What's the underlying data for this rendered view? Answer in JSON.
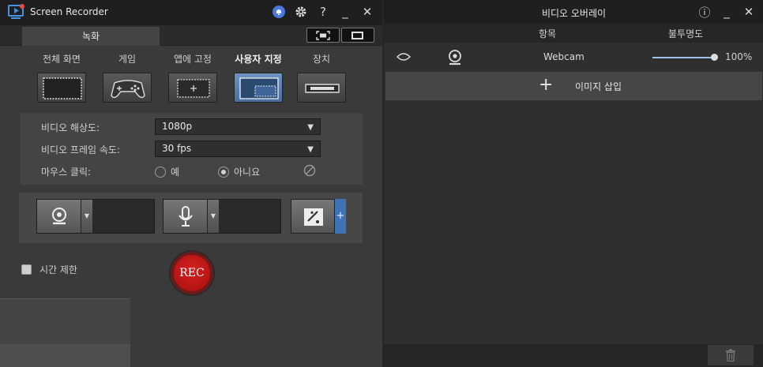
{
  "app": {
    "title": "Screen Recorder",
    "accent_color": "#4a78c0",
    "rec_color": "#c51616"
  },
  "titlebar": {
    "icons": [
      "notification-bell-icon",
      "gear-icon",
      "help-icon",
      "minimize-icon",
      "close-icon"
    ],
    "help_glyph": "?",
    "minimize_glyph": "_",
    "close_glyph": "✕"
  },
  "tabs": {
    "record_label": "녹화"
  },
  "modes": [
    {
      "label": "전체 화면",
      "icon": "full-screen-icon",
      "active": false
    },
    {
      "label": "게임",
      "icon": "gamepad-icon",
      "active": false
    },
    {
      "label": "앱에 고정",
      "icon": "lock-to-app-icon",
      "active": false
    },
    {
      "label": "사용자 지정",
      "icon": "custom-area-icon",
      "active": true
    },
    {
      "label": "장치",
      "icon": "device-icon",
      "active": false
    }
  ],
  "settings": {
    "resolution_label": "비디오 해상도:",
    "resolution_value": "1080p",
    "framerate_label": "비디오 프레임 속도:",
    "framerate_value": "30 fps",
    "mouse_click_label": "마우스 클릭:",
    "mouse_yes": "예",
    "mouse_no": "아니요",
    "mouse_selected": "no"
  },
  "devices": {
    "webcam_icon": "webcam-icon",
    "mic_icon": "microphone-icon",
    "effects_icon": "effects-icon",
    "add_glyph": "+",
    "dropdown_glyph": "▼"
  },
  "time_limit": {
    "label": "시간 제한",
    "checked": false
  },
  "rec_button": {
    "label": "REC"
  },
  "overlay_panel": {
    "title": "비디오 오버레이",
    "col_item": "항목",
    "col_opacity": "불투명도",
    "rows": [
      {
        "name": "Webcam",
        "visible": true,
        "opacity_percent": 100,
        "opacity_label": "100%"
      }
    ],
    "insert_label": "이미지 삽입",
    "insert_glyph": "+",
    "info_glyph": "ⓘ",
    "minimize_glyph": "_",
    "close_glyph": "✕"
  }
}
